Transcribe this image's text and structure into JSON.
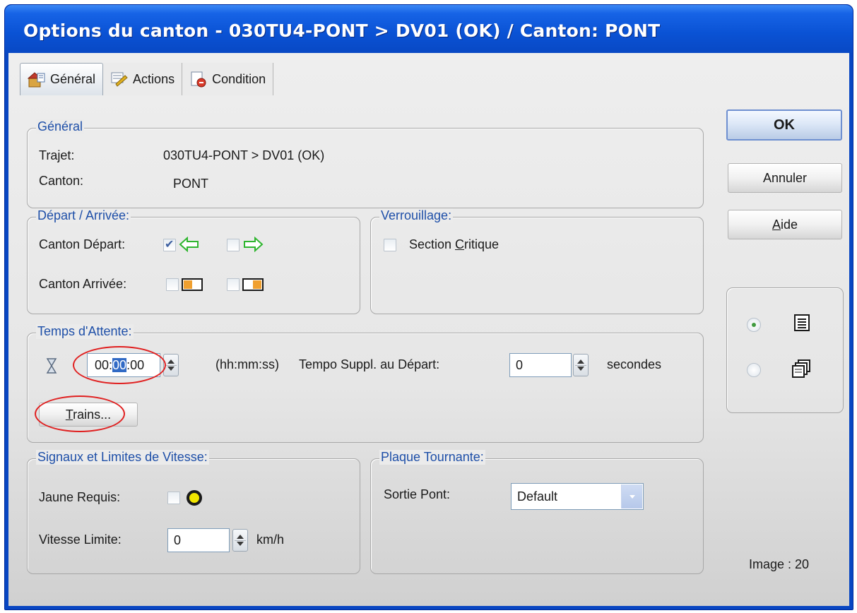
{
  "window": {
    "title": "Options du canton - 030TU4-PONT > DV01 (OK) / Canton: PONT"
  },
  "tabs": [
    {
      "label": "Général",
      "icon": "general-icon"
    },
    {
      "label": "Actions",
      "icon": "actions-icon"
    },
    {
      "label": "Condition",
      "icon": "condition-icon"
    }
  ],
  "general": {
    "legend": "Général",
    "trajet_label": "Trajet:",
    "trajet_value": "030TU4-PONT > DV01 (OK)",
    "canton_label": "Canton:",
    "canton_value": "PONT"
  },
  "depart": {
    "legend": "Départ / Arrivée:",
    "depart_label": "Canton Départ:",
    "arrivee_label": "Canton Arrivée:",
    "depart_left_checked": true,
    "depart_right_checked": false,
    "arrivee_left_checked": false,
    "arrivee_right_checked": false
  },
  "verrouillage": {
    "legend": "Verrouillage:",
    "section_critique_label": "Section Critique",
    "section_critique_checked": false
  },
  "attente": {
    "legend": "Temps d'Attente:",
    "time_hh": "00",
    "time_mm": "00",
    "time_ss": "00",
    "format_hint": "(hh:mm:ss)",
    "tempo_label": "Tempo Suppl. au Départ:",
    "tempo_value": "0",
    "tempo_unit": "secondes",
    "trains_button": "Trains..."
  },
  "signaux": {
    "legend": "Signaux et Limites de Vitesse:",
    "jaune_label": "Jaune Requis:",
    "jaune_checked": false,
    "vitesse_label": "Vitesse Limite:",
    "vitesse_value": "0",
    "vitesse_unit": "km/h"
  },
  "plaque": {
    "legend": "Plaque Tournante:",
    "sortie_label": "Sortie Pont:",
    "sortie_value": "Default"
  },
  "buttons": {
    "ok": "OK",
    "annuler": "Annuler",
    "aide": "Aide"
  },
  "view_mode": {
    "selected": "list"
  },
  "image_label": "Image : 20",
  "colors": {
    "title_blue": "#0a52d4",
    "legend_blue": "#1e4fa8",
    "annotation_red": "#e02020",
    "arrow_green": "#3cc93c"
  }
}
